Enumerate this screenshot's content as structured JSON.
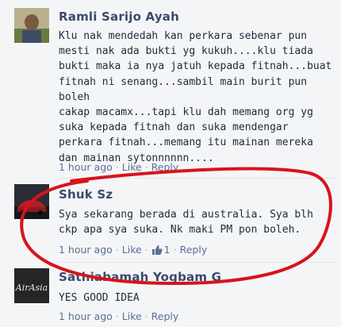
{
  "comments": [
    {
      "author": "Ramli Sarijo Ayah",
      "text": "Klu nak mendedah kan perkara sebenar pun\nmesti nak ada bukti yg kukuh....klu tiada\nbukti maka ia nya jatuh kepada fitnah...buat\nfitnah ni senang...sambil main burit pun boleh\ncakap macamx...tapi klu dah memang org yg\nsuka kepada fitnah dan suka mendengar\nperkara fitnah...memang itu mainan mereka\ndan mainan sytonnnnnn....",
      "time": "1 hour ago",
      "like": "Like",
      "reply": "Reply"
    },
    {
      "author": "Shuk Sz",
      "text": "Sya sekarang berada di australia. Sya blh\nckp apa sya suka. Nk maki PM pon boleh.",
      "time": "1 hour ago",
      "like": "Like",
      "like_count": "1",
      "reply": "Reply"
    },
    {
      "author": "Sathiabamah Yogbam G",
      "text": "YES GOOD IDEA",
      "time": "1 hour ago",
      "like": "Like",
      "reply": "Reply",
      "avatar_text": "AirAsia"
    }
  ],
  "colors": {
    "highlight": "#d9131b",
    "name": "#3b4a6b",
    "link": "#5b6f96"
  },
  "icons": [
    "thumbs-up-icon"
  ]
}
